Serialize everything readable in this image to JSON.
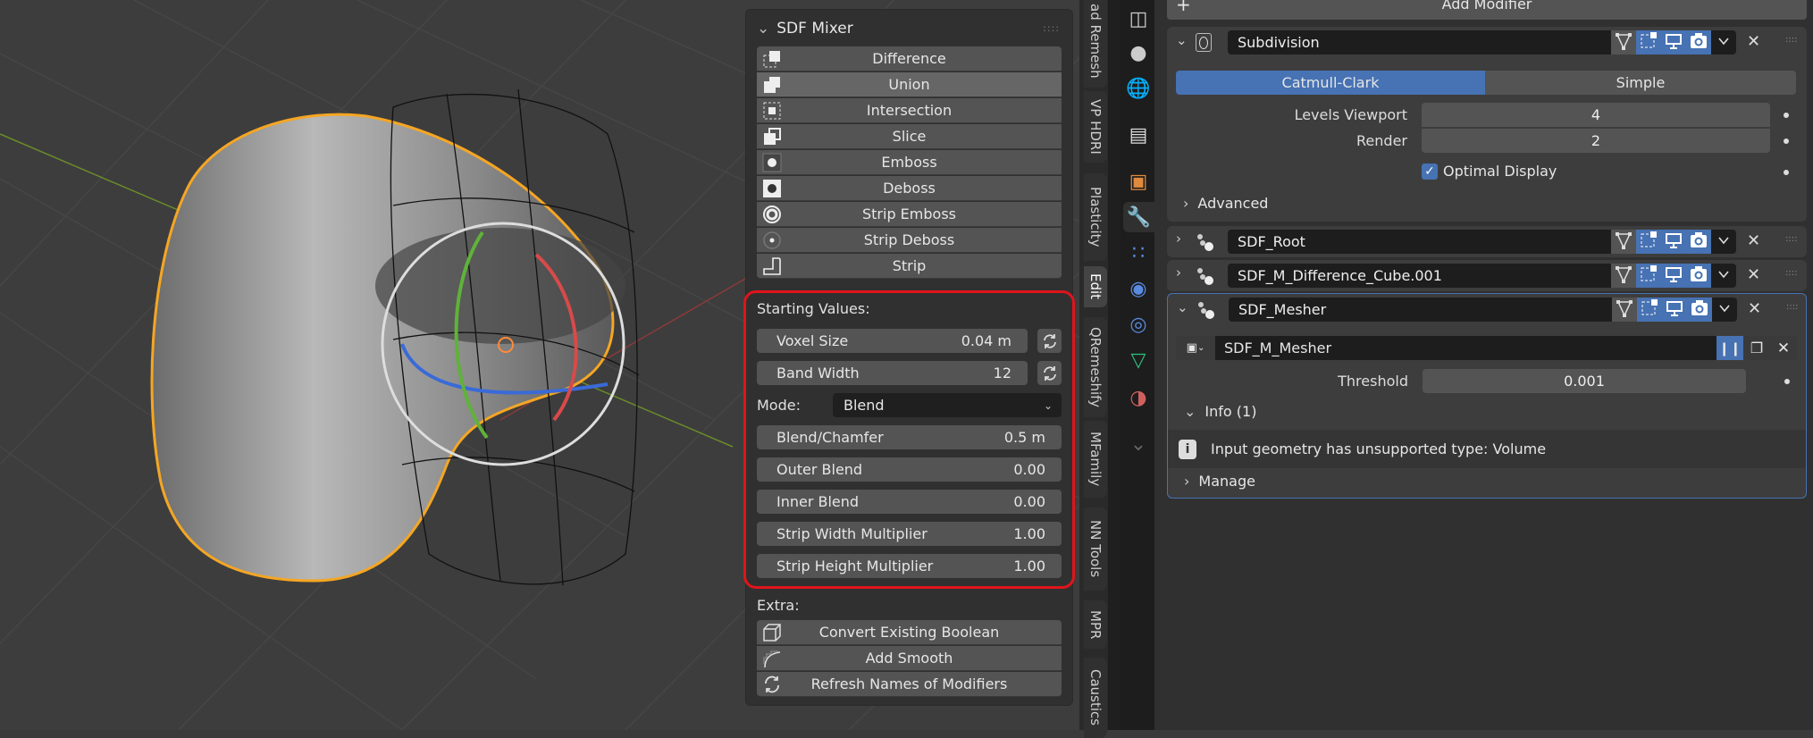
{
  "sdf_mixer": {
    "title": "SDF Mixer",
    "operations": [
      {
        "label": "Difference",
        "icon": "difference-icon"
      },
      {
        "label": "Union",
        "icon": "union-icon",
        "active": true
      },
      {
        "label": "Intersection",
        "icon": "intersection-icon"
      },
      {
        "label": "Slice",
        "icon": "slice-icon"
      },
      {
        "label": "Emboss",
        "icon": "emboss-icon"
      },
      {
        "label": "Deboss",
        "icon": "deboss-icon"
      },
      {
        "label": "Strip Emboss",
        "icon": "strip-emboss-icon"
      },
      {
        "label": "Strip Deboss",
        "icon": "strip-deboss-icon"
      },
      {
        "label": "Strip",
        "icon": "strip-icon"
      }
    ],
    "starting_values_label": "Starting Values:",
    "voxel_size": {
      "label": "Voxel Size",
      "value": "0.04 m"
    },
    "band_width": {
      "label": "Band Width",
      "value": "12"
    },
    "mode": {
      "label": "Mode:",
      "value": "Blend"
    },
    "params": [
      {
        "label": "Blend/Chamfer",
        "value": "0.5 m"
      },
      {
        "label": "Outer Blend",
        "value": "0.00"
      },
      {
        "label": "Inner Blend",
        "value": "0.00"
      },
      {
        "label": "Strip Width Multiplier",
        "value": "1.00"
      },
      {
        "label": "Strip Height Multiplier",
        "value": "1.00"
      }
    ],
    "extra_label": "Extra:",
    "extra_buttons": [
      {
        "label": "Convert Existing Boolean",
        "icon": "cube-icon"
      },
      {
        "label": "Add Smooth",
        "icon": "smooth-curve-icon"
      },
      {
        "label": "Refresh Names of Modifiers",
        "icon": "refresh-icon"
      }
    ]
  },
  "sidebar_tabs": [
    "ad Remesh",
    "VP HDRI",
    "Plasticity",
    "Edit",
    "QRemeshify",
    "MFamily",
    "NN Tools",
    "MPR",
    "Caustics"
  ],
  "active_tab": "Edit",
  "properties_icons": [
    "render-layers-icon",
    "scene-icon",
    "world-icon",
    "collection-icon",
    "object-icon",
    "wrench-icon",
    "particles-icon",
    "physics-icon",
    "constraints-icon",
    "object-data-icon",
    "material-icon",
    "chevron-down-icon"
  ],
  "modifiers": {
    "add_label": "Add Modifier",
    "subdivision": {
      "name": "Subdivision",
      "types": [
        "Catmull-Clark",
        "Simple"
      ],
      "levels_viewport": {
        "label": "Levels Viewport",
        "value": "4"
      },
      "render": {
        "label": "Render",
        "value": "2"
      },
      "optimal_display": {
        "label": "Optimal Display",
        "checked": true
      },
      "advanced_label": "Advanced"
    },
    "sdf_root": {
      "name": "SDF_Root"
    },
    "sdf_difference": {
      "name": "SDF_M_Difference_Cube.001"
    },
    "sdf_mesher": {
      "name": "SDF_Mesher",
      "node_group": "SDF_M_Mesher",
      "threshold": {
        "label": "Threshold",
        "value": "0.001"
      },
      "info_label": "Info (1)",
      "info_message": "Input geometry has unsupported type: Volume",
      "manage_label": "Manage"
    }
  },
  "colors": {
    "accent": "#4772b3",
    "selection": "#f5a623",
    "highlight_box": "#e0141b"
  }
}
